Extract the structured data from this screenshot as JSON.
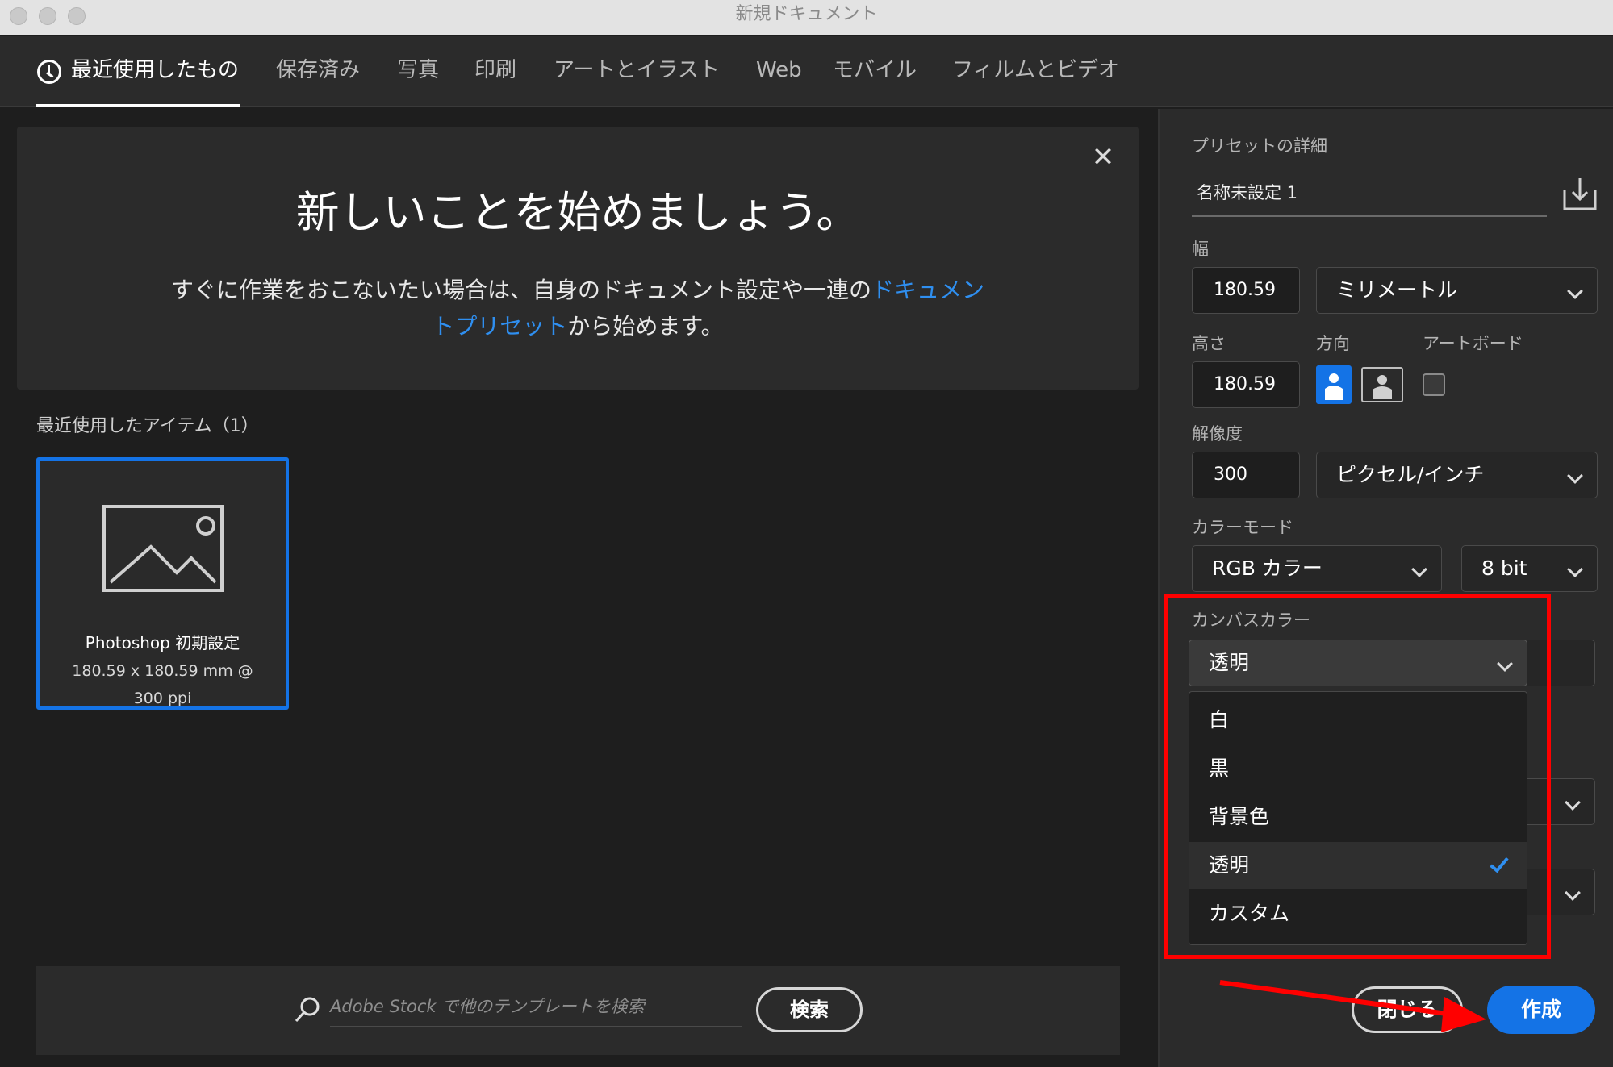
{
  "window": {
    "title": "新規ドキュメント"
  },
  "tabs": [
    {
      "label": "最近使用したもの",
      "active": true
    },
    {
      "label": "保存済み"
    },
    {
      "label": "写真"
    },
    {
      "label": "印刷"
    },
    {
      "label": "アートとイラスト"
    },
    {
      "label": "Web"
    },
    {
      "label": "モバイル"
    },
    {
      "label": "フィルムとビデオ"
    }
  ],
  "banner": {
    "title": "新しいことを始めましょう。",
    "text_before": "すぐに作業をおこないたい場合は、自身のドキュメント設定や一連の",
    "link": "ドキュメントプリセット",
    "text_after": "から始めます。"
  },
  "recent": {
    "label": "最近使用したアイテム（1）",
    "item": {
      "title": "Photoshop 初期設定",
      "subtitle": "180.59 x 180.59 mm @ 300 ppi"
    }
  },
  "search": {
    "placeholder": "Adobe Stock で他のテンプレートを検索",
    "button": "検索"
  },
  "preset": {
    "heading": "プリセットの詳細",
    "name": "名称未設定 1",
    "width_label": "幅",
    "width_value": "180.59",
    "width_unit": "ミリメートル",
    "height_label": "高さ",
    "height_value": "180.59",
    "orientation_label": "方向",
    "artboard_label": "アートボード",
    "resolution_label": "解像度",
    "resolution_value": "300",
    "resolution_unit": "ピクセル/インチ",
    "color_mode_label": "カラーモード",
    "color_mode": "RGB カラー",
    "bit_depth": "8 bit",
    "canvas_color_label": "カンバスカラー",
    "canvas_color": "透明",
    "canvas_options": [
      "白",
      "黒",
      "背景色",
      "透明",
      "カスタム"
    ],
    "selected_option": "透明"
  },
  "buttons": {
    "close": "閉じる",
    "create": "作成"
  },
  "colors": {
    "accent": "#1473e6",
    "link": "#2f8ff0",
    "highlight": "#ff0000"
  }
}
